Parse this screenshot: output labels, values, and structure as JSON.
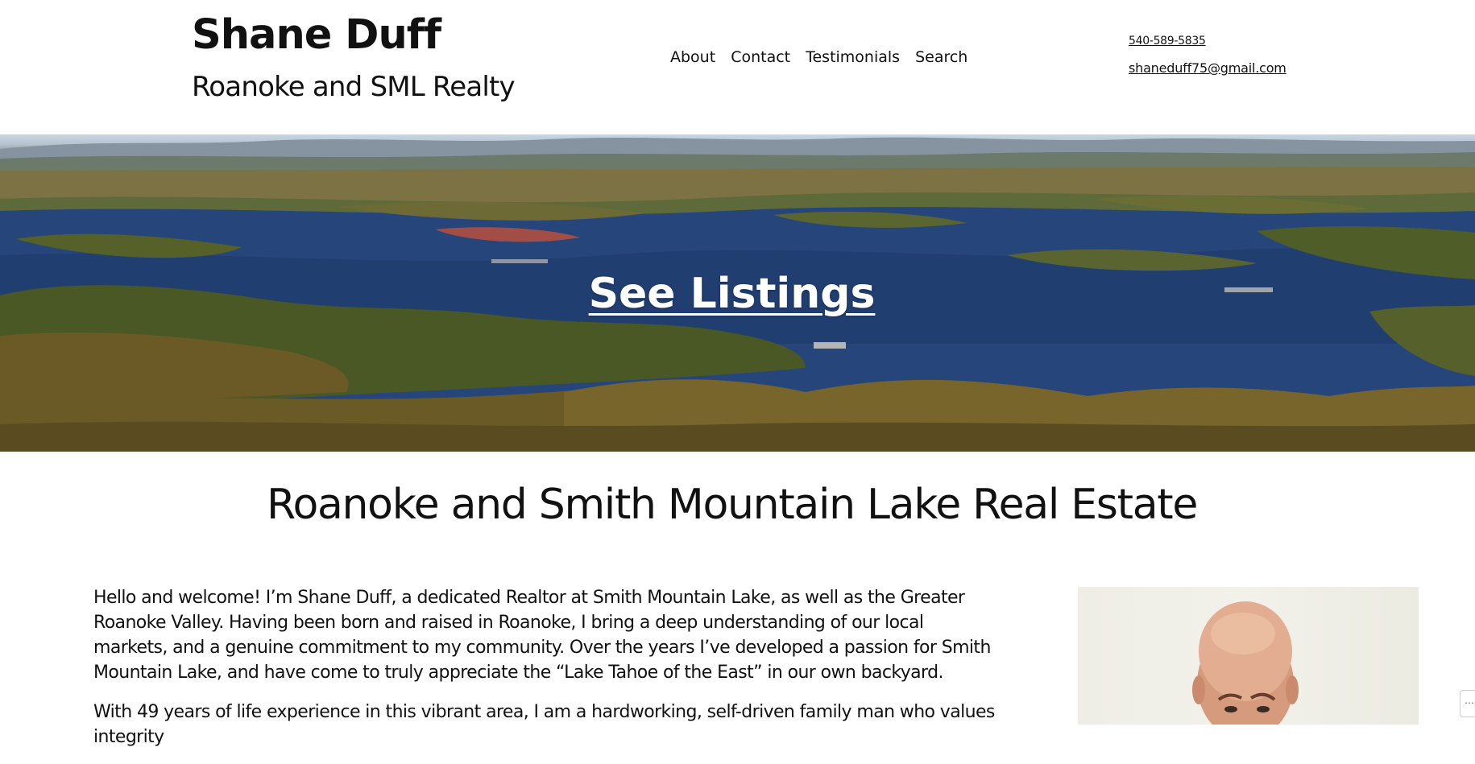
{
  "site": {
    "title": "Shane Duff",
    "tagline": "Roanoke and SML Realty"
  },
  "nav": {
    "items": [
      {
        "label": "About"
      },
      {
        "label": "Contact"
      },
      {
        "label": "Testimonials"
      },
      {
        "label": "Search"
      }
    ]
  },
  "contact": {
    "phone": "540-589-5835",
    "email": "shaneduff75@gmail.com"
  },
  "hero": {
    "cta": "See Listings"
  },
  "main": {
    "heading": "Roanoke and Smith Mountain Lake Real Estate",
    "paragraphs": [
      "Hello and welcome! I’m Shane Duff, a dedicated Realtor at Smith Mountain Lake, as well as the Greater Roanoke Valley. Having been born and raised in Roanoke, I bring a deep understanding of our local markets, and a genuine commitment to my community. Over the years I’ve developed a passion for Smith Mountain Lake, and have come to truly appreciate the “Lake Tahoe of the East” in our own backyard.",
      "With 49 years of life experience in this vibrant area, I am a hardworking, self-driven family man who values integrity"
    ]
  },
  "widget": {
    "icon": "ellipsis-icon"
  }
}
